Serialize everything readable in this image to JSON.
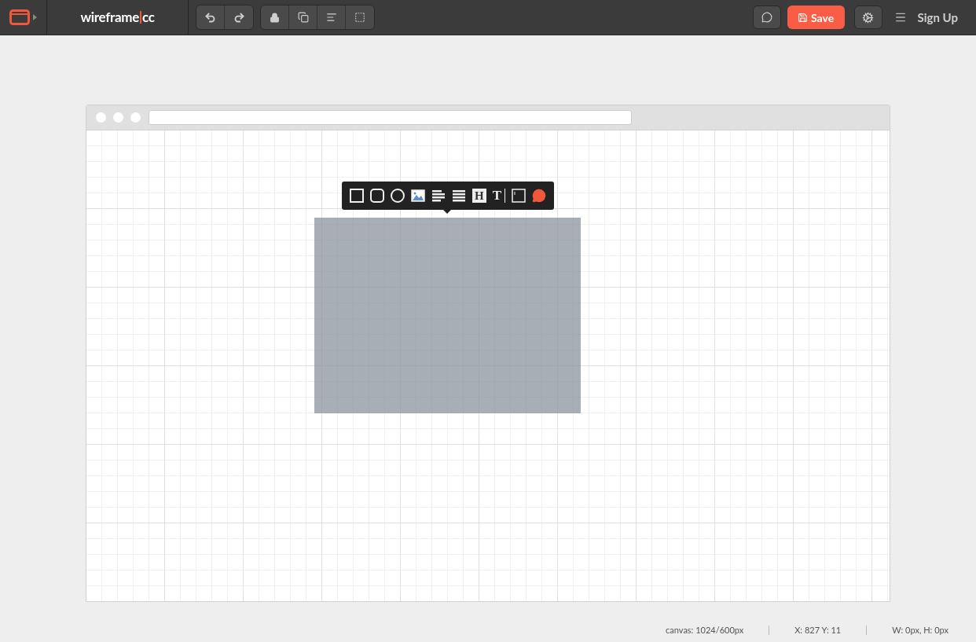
{
  "logo": {
    "name": "wireframe",
    "suffix": "cc"
  },
  "header": {
    "save_label": "Save",
    "signup_label": "Sign Up"
  },
  "toolbar": {
    "tools": [
      {
        "kind": "square"
      },
      {
        "kind": "rounded"
      },
      {
        "kind": "circle"
      },
      {
        "kind": "image"
      },
      {
        "kind": "paragraph"
      },
      {
        "kind": "list"
      },
      {
        "kind": "heading",
        "glyph": "H"
      },
      {
        "kind": "text",
        "glyph": "T"
      },
      {
        "kind": "input"
      },
      {
        "kind": "comment"
      }
    ]
  },
  "status_bar": [
    "canvas: 1024/600px",
    "X: 827 Y: 11",
    "W: 0px, H: 0px"
  ]
}
